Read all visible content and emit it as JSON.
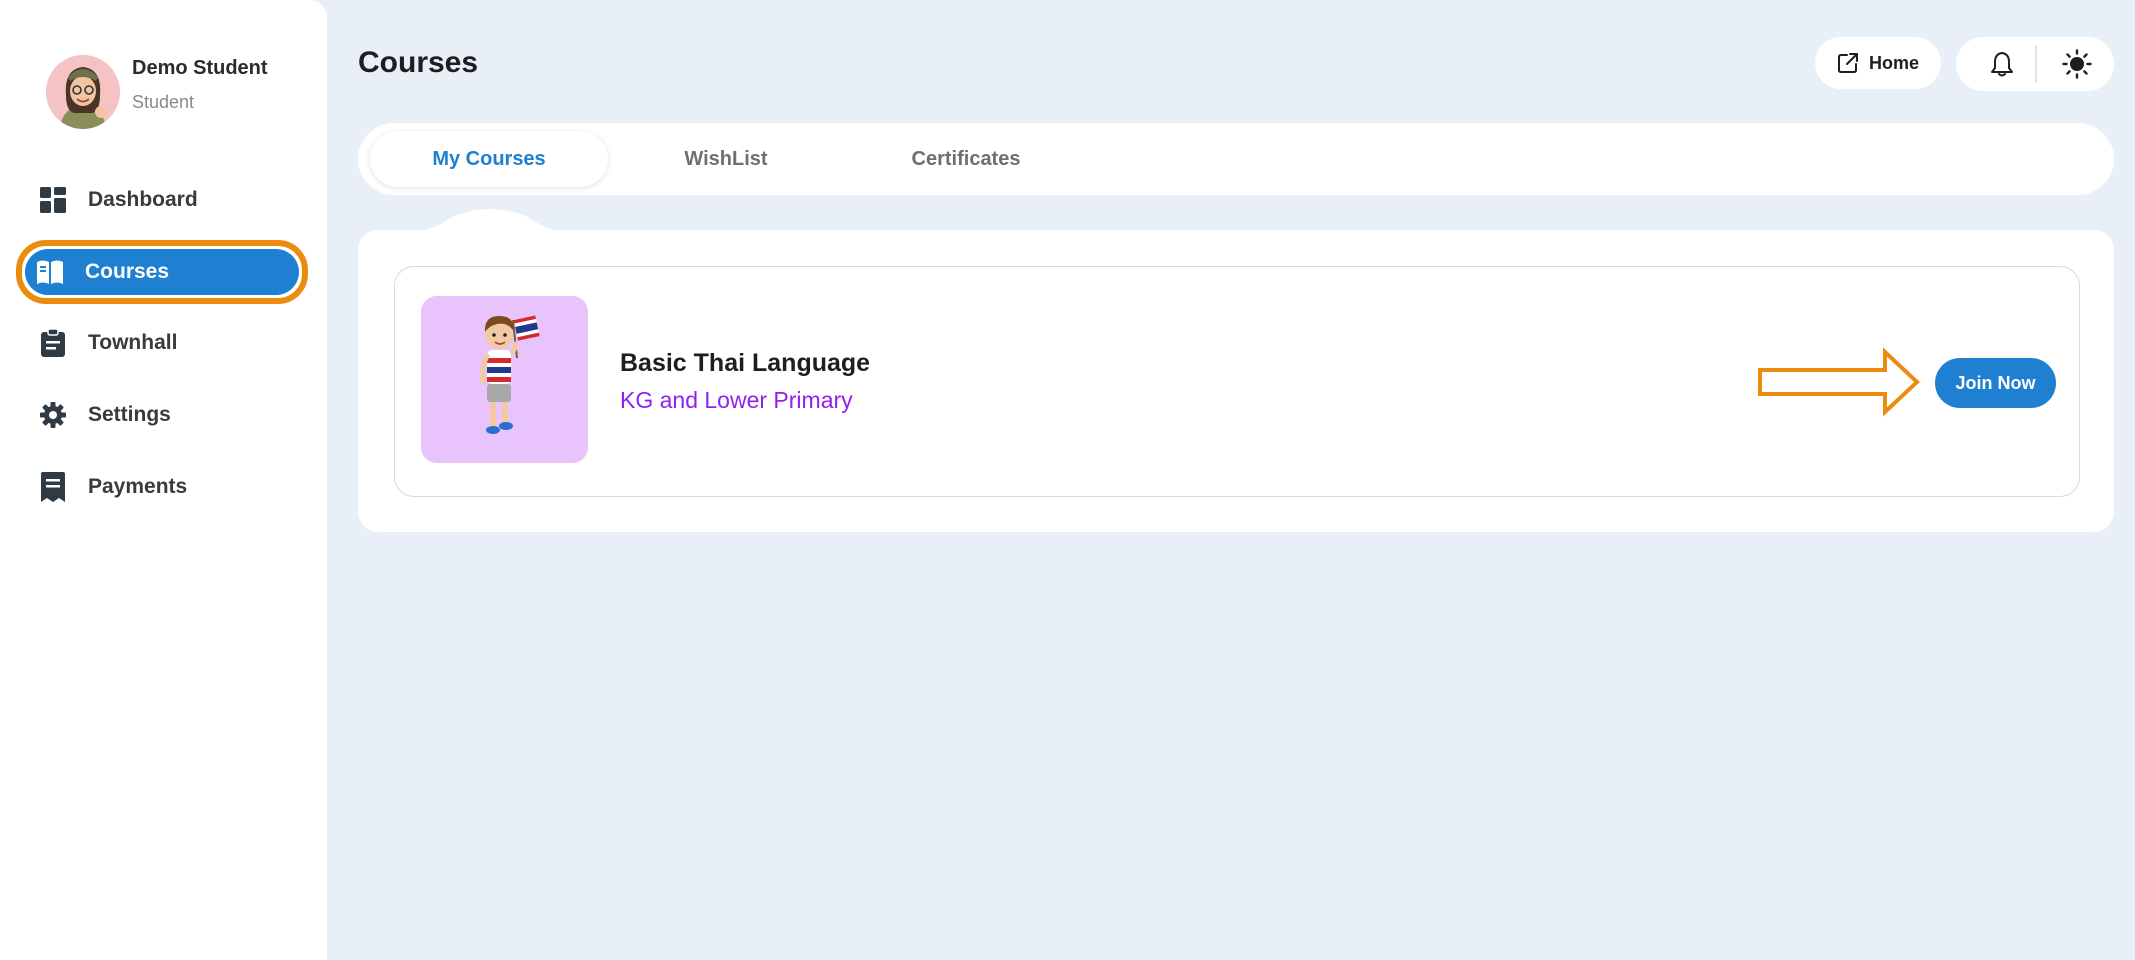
{
  "profile": {
    "name": "Demo Student",
    "role": "Student"
  },
  "sidebar": {
    "items": [
      {
        "label": "Dashboard",
        "icon": "dashboard-grid-icon",
        "active": false
      },
      {
        "label": "Courses",
        "icon": "open-book-icon",
        "active": true
      },
      {
        "label": "Townhall",
        "icon": "clipboard-icon",
        "active": false
      },
      {
        "label": "Settings",
        "icon": "gear-icon",
        "active": false
      },
      {
        "label": "Payments",
        "icon": "receipt-icon",
        "active": false
      }
    ]
  },
  "header": {
    "title": "Courses",
    "home_label": "Home",
    "icons": [
      "external-link-icon",
      "bell-icon",
      "sun-icon"
    ]
  },
  "tabs": [
    {
      "label": "My Courses",
      "active": true
    },
    {
      "label": "WishList",
      "active": false
    },
    {
      "label": "Certificates",
      "active": false
    }
  ],
  "courses": [
    {
      "title": "Basic Thai Language",
      "level": "KG and Lower Primary",
      "action_label": "Join Now"
    }
  ],
  "colors": {
    "accent_blue": "#1f7fd1",
    "highlight_orange": "#ec8b0d",
    "level_purple": "#8f21f0",
    "thumb_bg": "#e9c3fb",
    "page_bg": "#e8eff7"
  }
}
